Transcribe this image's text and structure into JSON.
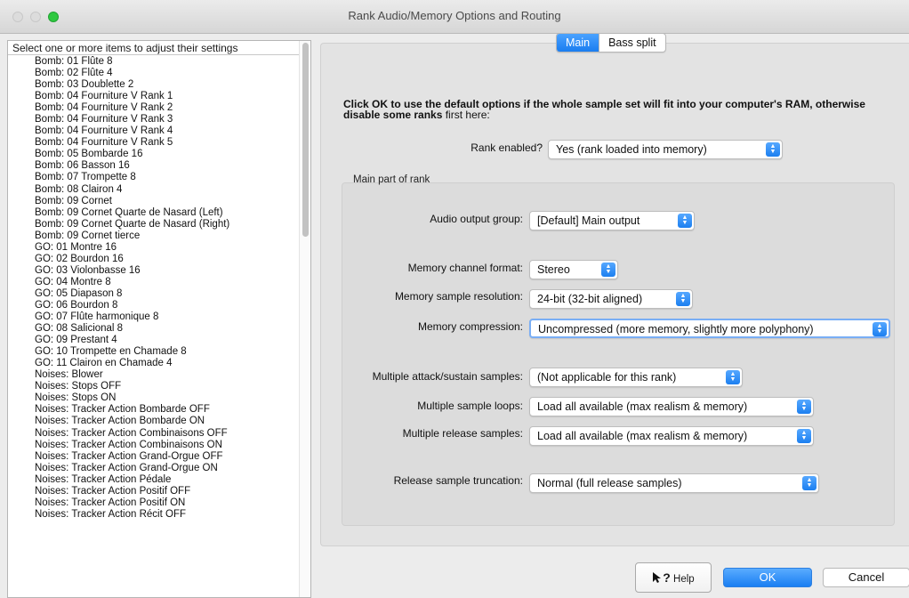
{
  "window": {
    "title": "Rank Audio/Memory Options and Routing"
  },
  "list": {
    "header": "Select one or more items to adjust their settings",
    "items": [
      "Bomb: 01 Flûte 8",
      "Bomb: 02 Flûte 4",
      "Bomb: 03 Doublette 2",
      "Bomb: 04 Fourniture V Rank 1",
      "Bomb: 04 Fourniture V Rank 2",
      "Bomb: 04 Fourniture V Rank 3",
      "Bomb: 04 Fourniture V Rank 4",
      "Bomb: 04 Fourniture V Rank 5",
      "Bomb: 05 Bombarde 16",
      "Bomb: 06 Basson 16",
      "Bomb: 07 Trompette 8",
      "Bomb: 08 Clairon 4",
      "Bomb: 09 Cornet",
      "Bomb: 09 Cornet Quarte de Nasard (Left)",
      "Bomb: 09 Cornet Quarte de Nasard (Right)",
      "Bomb: 09 Cornet tierce",
      "GO: 01 Montre 16",
      "GO: 02 Bourdon 16",
      "GO: 03 Violonbasse 16",
      "GO: 04 Montre 8",
      "GO: 05 Diapason 8",
      "GO: 06 Bourdon 8",
      "GO: 07 Flûte harmonique 8",
      "GO: 08 Salicional 8",
      "GO: 09 Prestant 4",
      "GO: 10 Trompette en Chamade 8",
      "GO: 11 Clairon en Chamade 4",
      "Noises: Blower",
      "Noises: Stops OFF",
      "Noises: Stops ON",
      "Noises: Tracker Action Bombarde OFF",
      "Noises: Tracker Action Bombarde ON",
      "Noises: Tracker Action Combinaisons OFF",
      "Noises: Tracker Action Combinaisons ON",
      "Noises: Tracker Action Grand-Orgue OFF",
      "Noises: Tracker Action Grand-Orgue ON",
      "Noises: Tracker Action Pédale",
      "Noises: Tracker Action Positif OFF",
      "Noises: Tracker Action Positif ON",
      "Noises: Tracker Action Récit OFF"
    ]
  },
  "tabs": {
    "main": "Main",
    "bass_split": "Bass split"
  },
  "instructions": {
    "bold": "Click OK to use the default options if the whole sample set will fit into your computer's RAM, otherwise disable some ranks",
    "normal": " first here:"
  },
  "rank_enabled": {
    "label": "Rank enabled?",
    "value": "Yes (rank loaded into memory)"
  },
  "group": {
    "title": "Main part of rank"
  },
  "fields": {
    "audio_output_group": {
      "label": "Audio output group:",
      "value": "[Default] Main output"
    },
    "memory_channel_format": {
      "label": "Memory channel format:",
      "value": "Stereo"
    },
    "memory_sample_resolution": {
      "label": "Memory sample resolution:",
      "value": "24-bit (32-bit aligned)"
    },
    "memory_compression": {
      "label": "Memory compression:",
      "value": "Uncompressed (more memory, slightly more polyphony)"
    },
    "multiple_attack_sustain": {
      "label": "Multiple attack/sustain samples:",
      "value": "(Not applicable for this rank)"
    },
    "multiple_sample_loops": {
      "label": "Multiple sample loops:",
      "value": "Load all available (max realism & memory)"
    },
    "multiple_release_samples": {
      "label": "Multiple release samples:",
      "value": "Load all available (max realism & memory)"
    },
    "release_truncation": {
      "label": "Release sample truncation:",
      "value": "Normal (full release samples)"
    }
  },
  "buttons": {
    "help": "Help",
    "help_glyph": "?",
    "ok": "OK",
    "cancel": "Cancel"
  }
}
